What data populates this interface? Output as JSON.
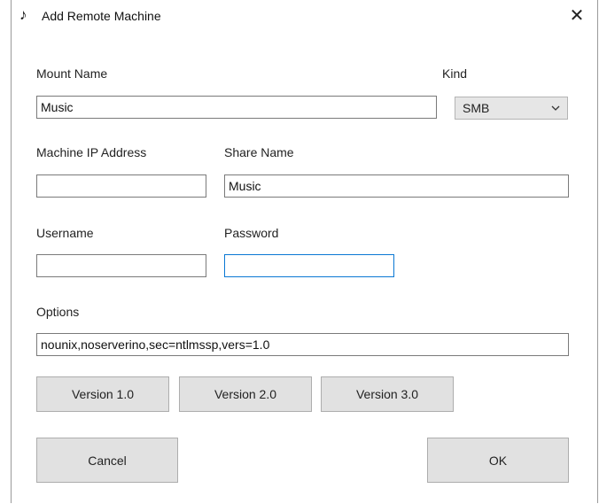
{
  "window": {
    "icon": "music-note-icon",
    "title": "Add Remote Machine",
    "close_glyph": "✕"
  },
  "form": {
    "mount_name": {
      "label": "Mount Name",
      "value": "Music"
    },
    "kind": {
      "label": "Kind",
      "selected": "SMB"
    },
    "machine_ip": {
      "label": "Machine IP Address",
      "value": ""
    },
    "share_name": {
      "label": "Share Name",
      "value": "Music"
    },
    "username": {
      "label": "Username",
      "value": ""
    },
    "password": {
      "label": "Password",
      "value": ""
    },
    "options": {
      "label": "Options",
      "value": "nounix,noserverino,sec=ntlmssp,vers=1.0"
    }
  },
  "version_buttons": [
    "Version 1.0",
    "Version 2.0",
    "Version 3.0"
  ],
  "actions": {
    "cancel": "Cancel",
    "ok": "OK"
  }
}
